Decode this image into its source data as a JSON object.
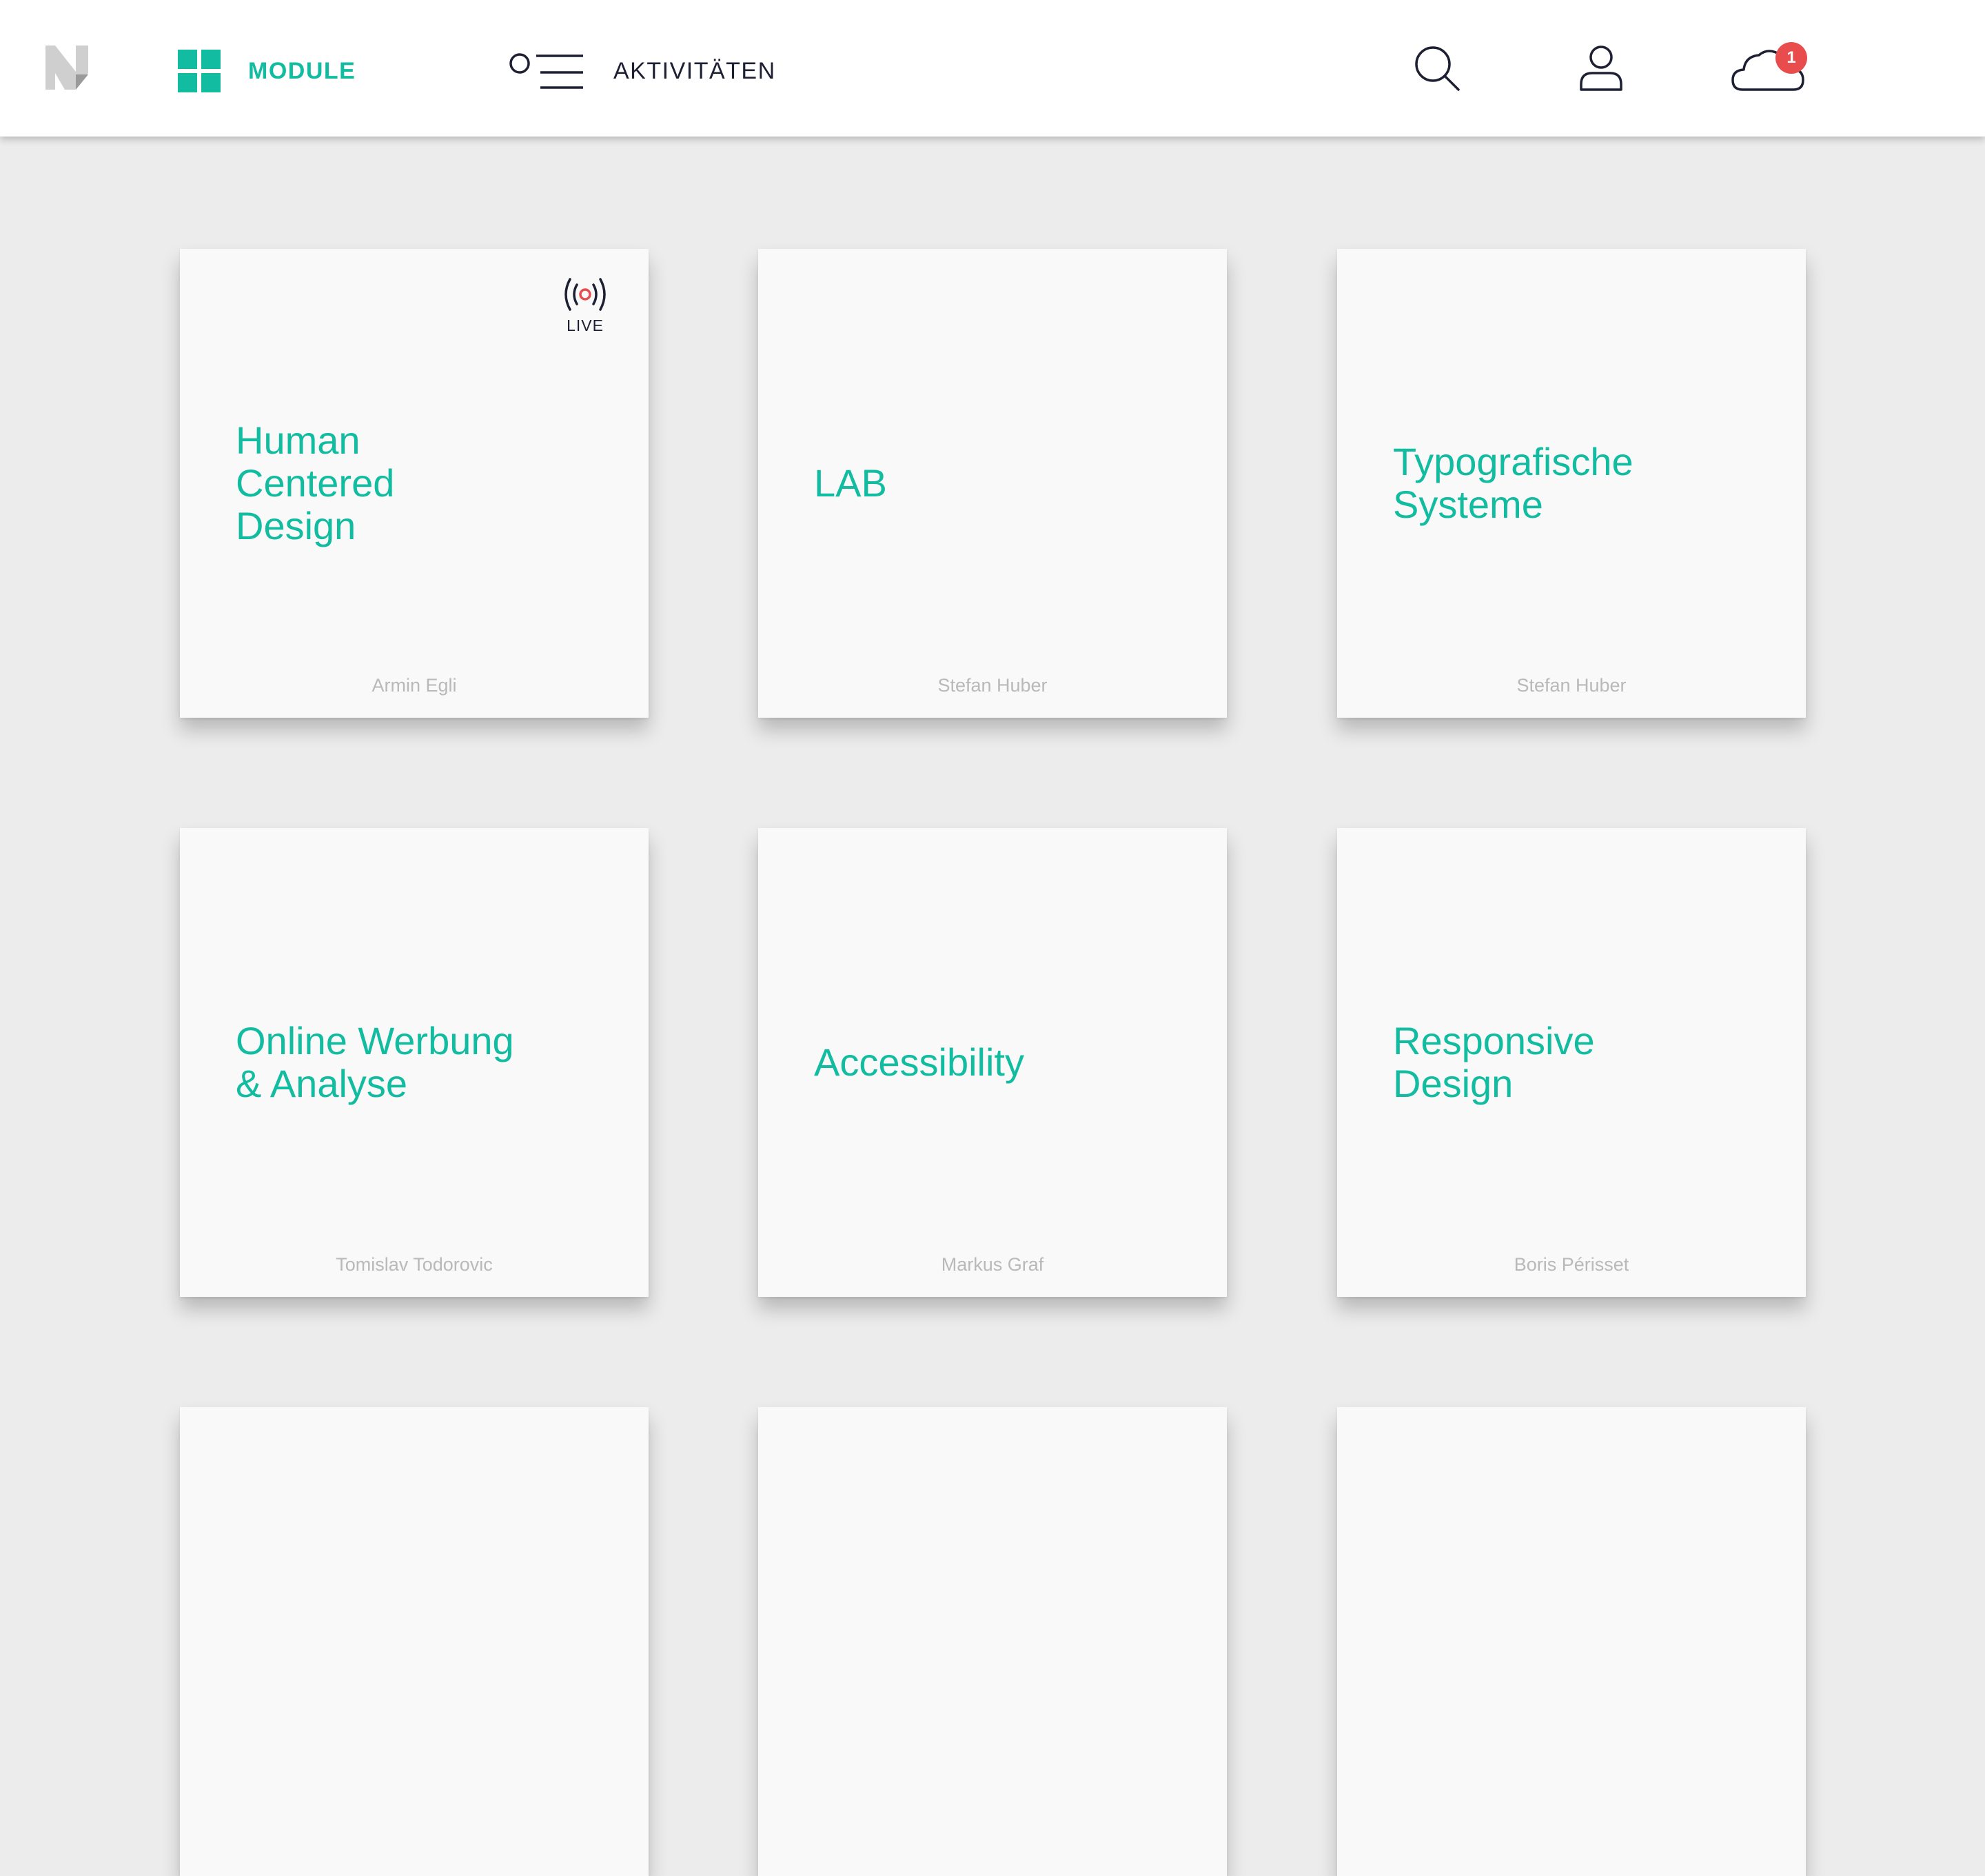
{
  "brand": {
    "accent": "#12bca0",
    "dark": "#1d1f33",
    "badge_color": "#e84c4c"
  },
  "nav": {
    "module_label": "MODULE",
    "module_icon": "grid-icon",
    "activities_label": "AKTIVITÄTEN",
    "activities_icon": "activity-list-icon"
  },
  "header": {
    "search_icon": "search-icon",
    "user_icon": "user-icon",
    "cloud_icon": "cloud-icon",
    "cloud_badge": "1"
  },
  "modules": [
    {
      "title": "Human\nCentered\nDesign",
      "author": "Armin Egli",
      "live": true,
      "live_label": "LIVE"
    },
    {
      "title": "LAB",
      "author": "Stefan Huber",
      "live": false
    },
    {
      "title": "Typografische\nSysteme",
      "author": "Stefan Huber",
      "live": false
    },
    {
      "title": "Online Werbung\n& Analyse",
      "author": "Tomislav Todorovic",
      "live": false
    },
    {
      "title": "Accessibility",
      "author": "Markus Graf",
      "live": false
    },
    {
      "title": "Responsive\nDesign",
      "author": "Boris Périsset",
      "live": false
    }
  ]
}
